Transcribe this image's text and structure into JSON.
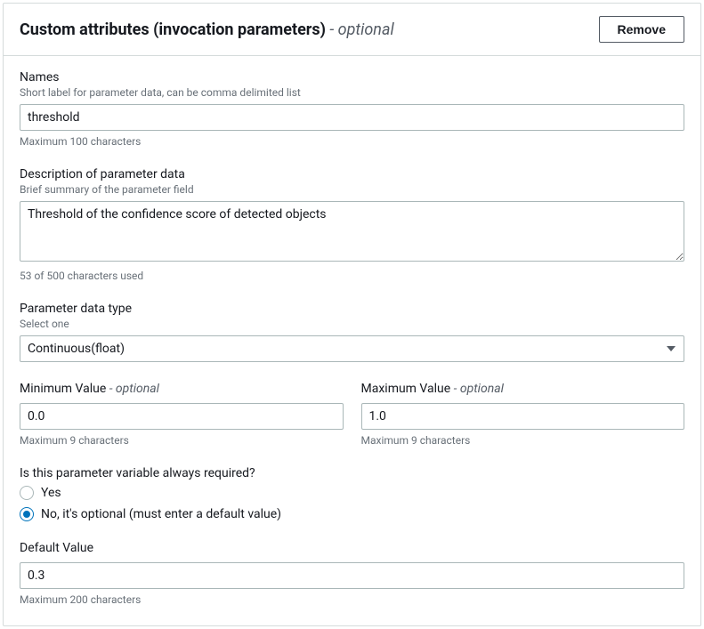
{
  "header": {
    "title": "Custom attributes (invocation parameters)",
    "titleSuffix": " - optional",
    "removeLabel": "Remove"
  },
  "names": {
    "label": "Names",
    "sublabel": "Short label for parameter data, can be comma delimited list",
    "value": "threshold",
    "hint": "Maximum 100 characters"
  },
  "description": {
    "label": "Description of parameter data",
    "sublabel": "Brief summary of the parameter field",
    "value": "Threshold of the confidence score of detected objects",
    "hint": "53 of 500 characters used"
  },
  "dataType": {
    "label": "Parameter data type",
    "sublabel": "Select one",
    "value": "Continuous(float)"
  },
  "minValue": {
    "label": "Minimum Value",
    "labelSuffix": " - optional",
    "value": "0.0",
    "hint": "Maximum 9 characters"
  },
  "maxValue": {
    "label": "Maximum Value",
    "labelSuffix": " - optional",
    "value": "1.0",
    "hint": "Maximum 9 characters"
  },
  "required": {
    "label": "Is this parameter variable always required?",
    "optionYes": "Yes",
    "optionNo": "No, it's optional (must enter a default value)",
    "selected": "no"
  },
  "defaultValue": {
    "label": "Default Value",
    "value": "0.3",
    "hint": "Maximum 200 characters"
  }
}
